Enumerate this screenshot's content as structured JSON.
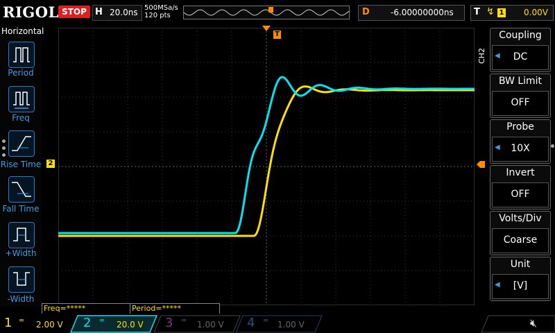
{
  "header": {
    "brand": "RIGOL",
    "run_state": "STOP",
    "horizontal": {
      "key": "H",
      "scale": "20.0ns"
    },
    "sample_rate": "500MSa/s",
    "points": "120 pts",
    "delay": {
      "key": "D",
      "value": "-6.00000000ns"
    },
    "trigger": {
      "key": "T",
      "source": "1",
      "level": "0.00V"
    }
  },
  "left_menu": {
    "title": "Horizontal",
    "items": [
      {
        "label": "Period"
      },
      {
        "label": "Freq"
      },
      {
        "label": "Rise Time"
      },
      {
        "label": "Fall Time"
      },
      {
        "label": "+Width"
      },
      {
        "label": "-Width"
      }
    ]
  },
  "right_menu": {
    "channel_label": "CH2",
    "items": [
      {
        "title": "Coupling",
        "value": "DC"
      },
      {
        "title": "BW Limit",
        "value": "OFF"
      },
      {
        "title": "Probe",
        "value": "10X"
      },
      {
        "title": "Invert",
        "value": "OFF"
      },
      {
        "title": "Volts/Div",
        "value": "Coarse"
      },
      {
        "title": "Unit",
        "value": "[V]"
      }
    ]
  },
  "measurements": {
    "freq": "Freq=*****",
    "period": "Period=*****"
  },
  "channels": [
    {
      "num": "1",
      "scale": "2.00 V",
      "color": "#ffe000"
    },
    {
      "num": "2",
      "scale": "20.0 V",
      "color": "#00e5f0"
    },
    {
      "num": "3",
      "scale": "1.00 V",
      "color": "#c020c0"
    },
    {
      "num": "4",
      "scale": "1.00 V",
      "color": "#2060d0"
    }
  ],
  "markers": {
    "trigger_tag": "T",
    "ch2_marker": "2"
  },
  "colors": {
    "ch1": "#ffe000",
    "ch2": "#00e5f0",
    "trigger": "#ff8c00",
    "menu_accent": "#2a78c8",
    "stop": "#e01e1e"
  }
}
